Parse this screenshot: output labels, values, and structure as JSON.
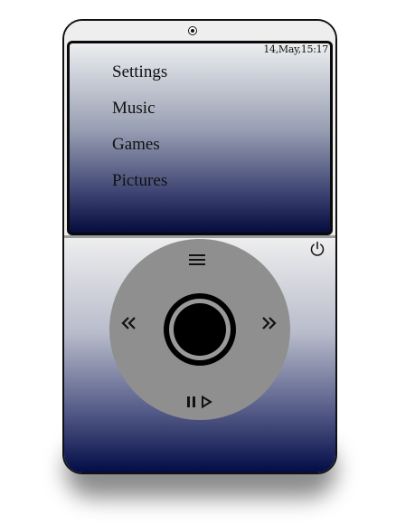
{
  "status": {
    "datetime": "14,May,15:17"
  },
  "menu": {
    "items": [
      {
        "label": "Settings"
      },
      {
        "label": "Music"
      },
      {
        "label": "Games"
      },
      {
        "label": "Pictures"
      }
    ]
  },
  "controls": {
    "icons": {
      "camera": "camera-icon",
      "power": "power-icon",
      "menu": "hamburger-menu-icon",
      "previous": "double-chevron-left-icon",
      "next": "double-chevron-right-icon",
      "play_pause": "play-pause-icon",
      "center": "center-select-button"
    }
  },
  "colors": {
    "device_body": "#eeeeee",
    "wheel": "#8f8f8f",
    "gradient_dark": "#050c3e",
    "outline": "#111111"
  }
}
